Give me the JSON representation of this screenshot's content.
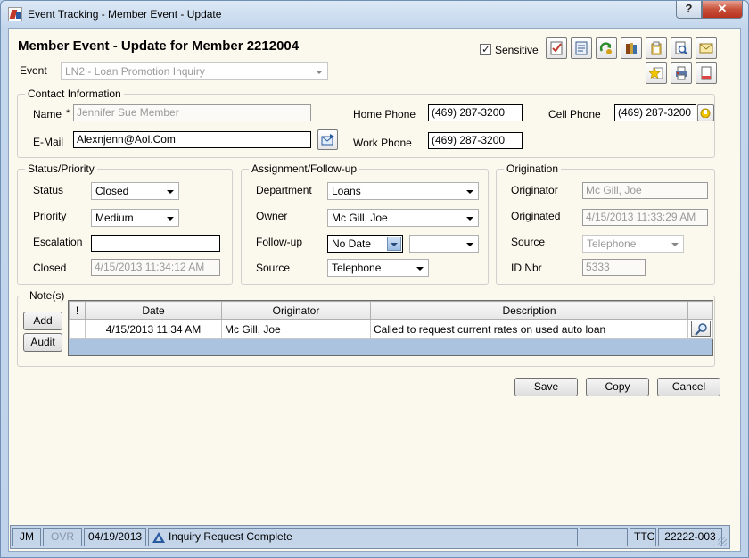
{
  "window": {
    "title": "Event Tracking - Member Event - Update",
    "help_label": "?",
    "close_label": "✕"
  },
  "header": {
    "title": "Member Event - Update for Member 2212004",
    "sensitive_label": "Sensitive",
    "sensitive_checked": true,
    "event_label": "Event",
    "event_value": "LN2 - Loan Promotion Inquiry"
  },
  "toolbar_icons": [
    "checklist-icon",
    "document-icon",
    "refresh-icon",
    "books-icon",
    "clipboard-icon",
    "search-document-icon",
    "envelope-icon",
    "star-icon",
    "print-icon",
    "page-icon"
  ],
  "contact": {
    "group_label": "Contact Information",
    "name_label": "Name",
    "required_mark": "*",
    "name_value": "Jennifer Sue Member",
    "email_label": "E-Mail",
    "email_value": "Alexnjenn@Aol.Com",
    "home_phone_label": "Home Phone",
    "home_phone_value": "(469) 287-3200",
    "work_phone_label": "Work Phone",
    "work_phone_value": "(469) 287-3200",
    "cell_phone_label": "Cell Phone",
    "cell_phone_value": "(469) 287-3200"
  },
  "status": {
    "group_label": "Status/Priority",
    "status_label": "Status",
    "status_value": "Closed",
    "priority_label": "Priority",
    "priority_value": "Medium",
    "escalation_label": "Escalation",
    "escalation_value": "",
    "closed_label": "Closed",
    "closed_value": "4/15/2013 11:34:12 AM"
  },
  "assignment": {
    "group_label": "Assignment/Follow-up",
    "department_label": "Department",
    "department_value": "Loans",
    "owner_label": "Owner",
    "owner_value": "Mc Gill, Joe",
    "followup_label": "Follow-up",
    "followup_value": "No Date",
    "followup_time": "",
    "source_label": "Source",
    "source_value": "Telephone"
  },
  "origination": {
    "group_label": "Origination",
    "originator_label": "Originator",
    "originator_value": "Mc Gill, Joe",
    "originated_label": "Originated",
    "originated_value": "4/15/2013 11:33:29 AM",
    "source_label": "Source",
    "source_value": "Telephone",
    "id_label": "ID Nbr",
    "id_value": "5333"
  },
  "notes": {
    "group_label": "Note(s)",
    "add_label": "Add",
    "audit_label": "Audit",
    "columns": [
      "!",
      "Date",
      "Originator",
      "Description"
    ],
    "rows": [
      {
        "flag": "",
        "date": "4/15/2013 11:34 AM",
        "originator": "Mc Gill, Joe",
        "description": "Called to request current rates on used auto loan"
      }
    ]
  },
  "actions": {
    "save": "Save",
    "copy": "Copy",
    "cancel": "Cancel"
  },
  "statusbar": {
    "user": "JM",
    "ovr": "OVR",
    "date": "04/19/2013",
    "message": "Inquiry Request Complete",
    "ttc": "TTC",
    "code": "22222-003"
  },
  "colors": {
    "title_bar": "#c3d6ec",
    "client_bg": "#fbf8ed",
    "close_red": "#c75039",
    "grid_fill": "#abc3de"
  }
}
